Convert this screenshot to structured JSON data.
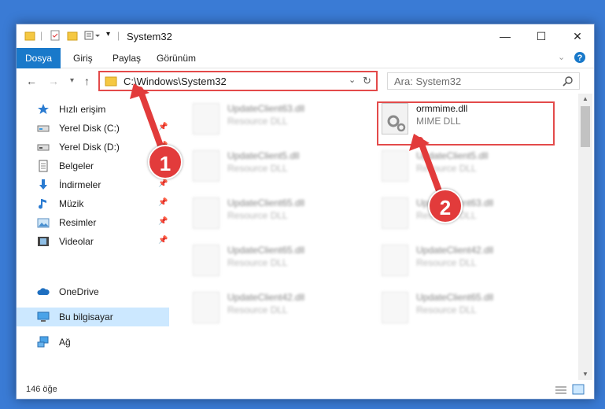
{
  "window": {
    "title": "System32",
    "controls": {
      "minimize": "—",
      "maximize": "☐",
      "close": "✕"
    }
  },
  "ribbon": {
    "tabs": [
      "Dosya",
      "Giriş",
      "Paylaş",
      "Görünüm"
    ]
  },
  "navigation": {
    "address": "C:\\Windows\\System32",
    "search_placeholder": "Ara: System32"
  },
  "sidebar": {
    "items": [
      {
        "label": "Hızlı erişim",
        "icon": "star-icon",
        "pinned": false
      },
      {
        "label": "Yerel Disk (C:)",
        "icon": "drive-icon",
        "pinned": true
      },
      {
        "label": "Yerel Disk (D:)",
        "icon": "drive-icon",
        "pinned": true
      },
      {
        "label": "Belgeler",
        "icon": "documents-icon",
        "pinned": true
      },
      {
        "label": "İndirmeler",
        "icon": "download-icon",
        "pinned": true
      },
      {
        "label": "Müzik",
        "icon": "music-icon",
        "pinned": true
      },
      {
        "label": "Resimler",
        "icon": "pictures-icon",
        "pinned": true
      },
      {
        "label": "Videolar",
        "icon": "video-icon",
        "pinned": true
      },
      {
        "label": "OneDrive",
        "icon": "cloud-icon",
        "pinned": false
      },
      {
        "label": "Bu bilgisayar",
        "icon": "computer-icon",
        "pinned": false,
        "selected": true
      },
      {
        "label": "Ağ",
        "icon": "network-icon",
        "pinned": false
      }
    ],
    "pin_glyph": "📌"
  },
  "files": {
    "highlighted": {
      "name": "ormmime.dll",
      "type": "MIME DLL"
    },
    "left_column": [
      {
        "name": "UpdateClient63.dll",
        "type": "Resource DLL"
      },
      {
        "name": "UpdateClient5.dll",
        "type": "Resource DLL"
      },
      {
        "name": "UpdateClient65.dll",
        "type": "Resource DLL"
      },
      {
        "name": "UpdateClient65.dll",
        "type": "Resource DLL"
      },
      {
        "name": "UpdateClient42.dll",
        "type": "Resource DLL"
      }
    ],
    "right_column": [
      {
        "name": "UpdateClient5.dll",
        "type": "Resource DLL"
      },
      {
        "name": "UpdateClient63.dll",
        "type": "Resource DLL"
      },
      {
        "name": "UpdateClient42.dll",
        "type": "Resource DLL"
      },
      {
        "name": "UpdateClient65.dll",
        "type": "Resource DLL"
      }
    ]
  },
  "annotations": {
    "step1": "1",
    "step2": "2",
    "color": "#e23b3b"
  },
  "status": {
    "count": "146 öğe"
  }
}
